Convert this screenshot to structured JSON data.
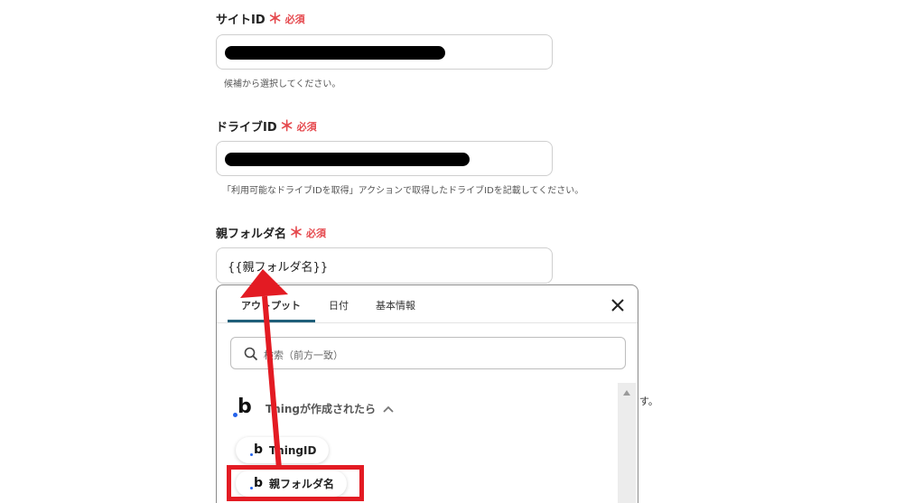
{
  "fields": {
    "site_id": {
      "label": "サイトID",
      "required_mark": "＊",
      "required_text": "必須",
      "helper": "候補から選択してください。"
    },
    "drive_id": {
      "label": "ドライブID",
      "required_mark": "＊",
      "required_text": "必須",
      "helper": "「利用可能なドライブIDを取得」アクションで取得したドライブIDを記載してください。"
    },
    "parent_folder": {
      "label": "親フォルダ名",
      "required_mark": "＊",
      "required_text": "必須",
      "value": "{{親フォルダ名}}"
    }
  },
  "panel": {
    "tabs": [
      {
        "label": "アウトプット",
        "active": true
      },
      {
        "label": "日付",
        "active": false
      },
      {
        "label": "基本情報",
        "active": false
      }
    ],
    "search_placeholder": "検索（前方一致）",
    "trigger": {
      "logo": "b",
      "label": "Thingが作成されたら"
    },
    "outputs": [
      {
        "logo": "b",
        "label": "ThingID"
      },
      {
        "logo": "b",
        "label": "親フォルダ名"
      }
    ]
  },
  "side_text": "す。",
  "colors": {
    "required": "#e5484d",
    "tab_active": "#1f5f7a",
    "annotation": "#e31b23",
    "logo_dot": "#2563eb"
  },
  "icons": {
    "close": "close-icon",
    "search": "search-icon",
    "chevron": "chevron-up-icon",
    "scroll": "scroll-up-arrow-icon"
  }
}
